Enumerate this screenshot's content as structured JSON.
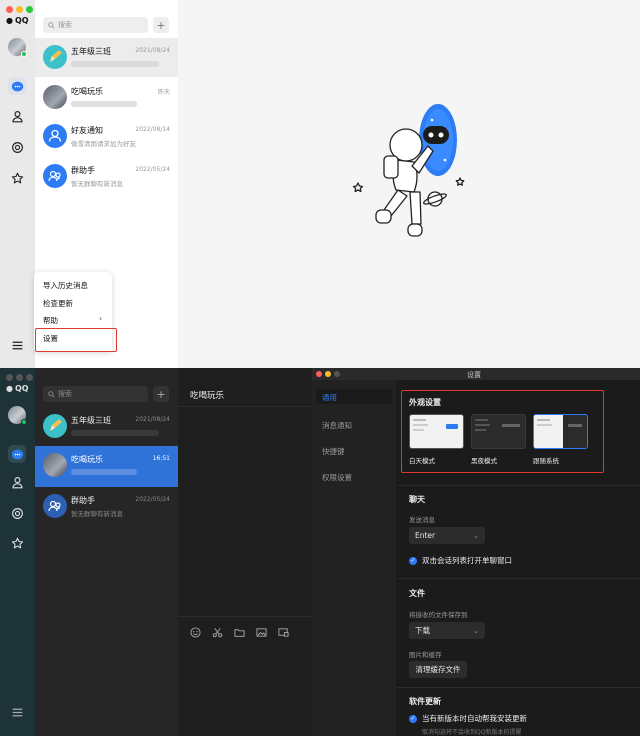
{
  "light": {
    "app_name": "QQ",
    "search_placeholder": "搜索",
    "conversations": [
      {
        "name": "五年级三班",
        "time": "2021/08/24",
        "preview": ""
      },
      {
        "name": "吃喝玩乐",
        "time": "昨天",
        "preview": ""
      },
      {
        "name": "好友通知",
        "time": "2022/08/14",
        "preview": "微雪清雨请求加为好友"
      },
      {
        "name": "群助手",
        "time": "2022/05/24",
        "preview": "暂无群聊有新消息"
      }
    ],
    "menu": {
      "items": [
        "导入历史消息",
        "检查更新",
        "帮助",
        "设置"
      ]
    }
  },
  "dark": {
    "app_name": "QQ",
    "search_placeholder": "搜索",
    "chat_title": "吃喝玩乐",
    "conversations": [
      {
        "name": "五年级三班",
        "time": "2021/08/24",
        "preview": ""
      },
      {
        "name": "吃喝玩乐",
        "time": "16:51",
        "preview": ""
      },
      {
        "name": "群助手",
        "time": "2022/05/24",
        "preview": "暂无群聊有新消息"
      }
    ]
  },
  "settings": {
    "window_title": "设置",
    "nav": [
      "通用",
      "消息通知",
      "快捷键",
      "权限设置"
    ],
    "appearance": {
      "title": "外观设置",
      "modes": [
        "白天模式",
        "黑夜模式",
        "跟随系统"
      ]
    },
    "chat": {
      "title": "聊天",
      "send_label": "发送消息",
      "send_value": "Enter",
      "open_window_label": "双击会话列表打开单聊窗口"
    },
    "file": {
      "title": "文件",
      "save_label": "将接收的文件保存到",
      "save_value": "下载",
      "cache_label": "图片和缓存",
      "clear_cache_button": "清理缓存文件"
    },
    "update": {
      "title": "软件更新",
      "auto_update_label": "当有新版本时自动帮我安装更新",
      "auto_update_sub": "取消勾选将不会收到QQ新版本的提醒"
    }
  },
  "colors": {
    "accent_blue": "#2d7cf6",
    "highlight_red": "#e03a2f",
    "dark_selected": "#2f73d9"
  }
}
